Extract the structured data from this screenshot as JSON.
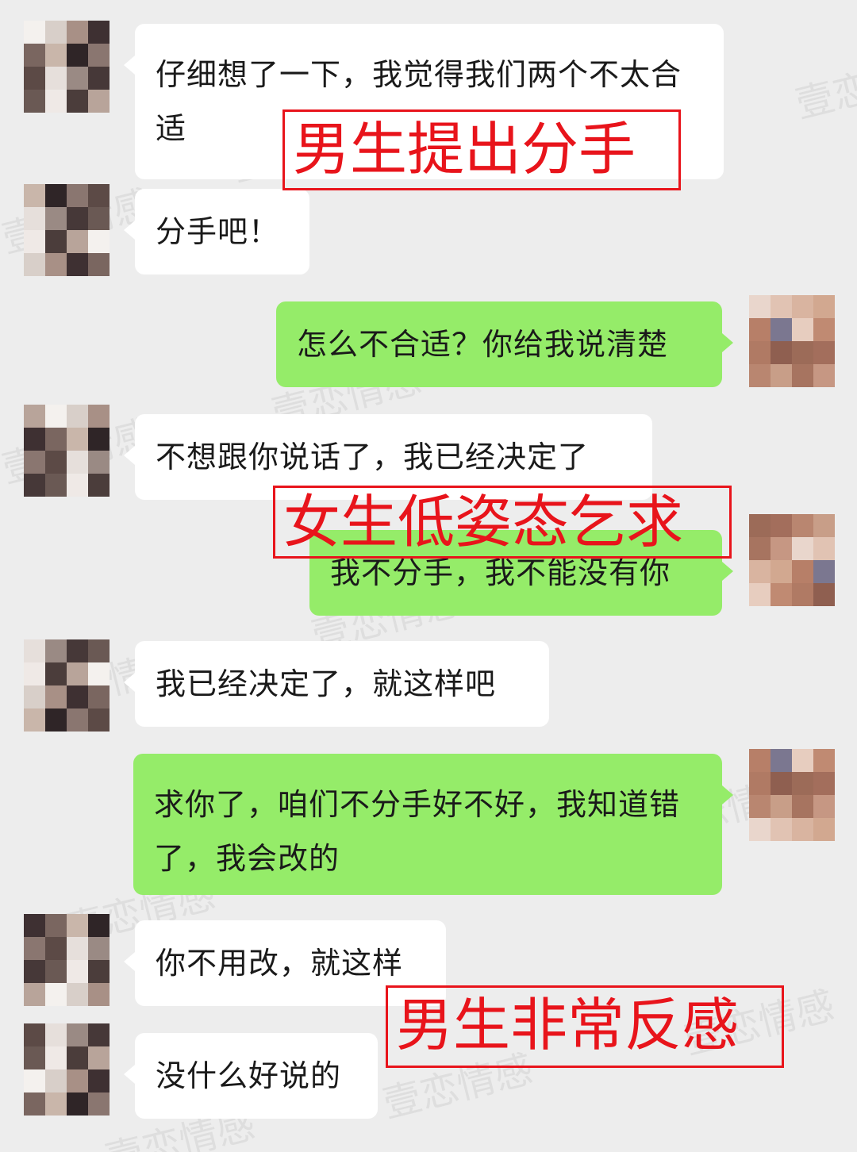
{
  "messages": [
    {
      "side": "in",
      "text": "仔细想了一下，我觉得我们两个不太合适"
    },
    {
      "side": "in",
      "text": "分手吧！"
    },
    {
      "side": "out",
      "text": "怎么不合适？你给我说清楚"
    },
    {
      "side": "in",
      "text": "不想跟你说话了，我已经决定了"
    },
    {
      "side": "out",
      "text": "我不分手，我不能没有你"
    },
    {
      "side": "in",
      "text": "我已经决定了，就这样吧"
    },
    {
      "side": "out",
      "text": "求你了，咱们不分手好不好，我知道错了，我会改的"
    },
    {
      "side": "in",
      "text": "你不用改，就这样"
    },
    {
      "side": "in",
      "text": "没什么好说的"
    }
  ],
  "annotations": [
    {
      "text": "男生提出分手"
    },
    {
      "text": "女生低姿态乞求"
    },
    {
      "text": "男生非常反感"
    }
  ],
  "watermark": "壹恋情感",
  "colors": {
    "background": "#ededed",
    "incoming_bubble": "#ffffff",
    "outgoing_bubble": "#95ec69",
    "annotation": "#e8141b"
  }
}
